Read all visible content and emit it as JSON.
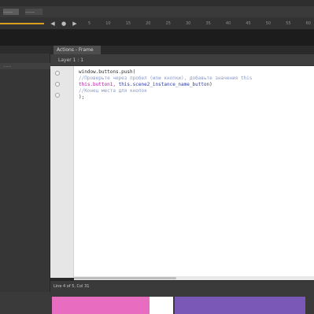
{
  "menubar": {
    "items": [
      "……",
      "……"
    ]
  },
  "timeline": {
    "buttons": [
      "◀",
      "●",
      "▶"
    ],
    "frame_numbers": [
      "5",
      "10",
      "15",
      "20",
      "25",
      "30",
      "35",
      "40",
      "45",
      "50",
      "55",
      "60"
    ],
    "accent_color": "#d9a020"
  },
  "left_panel": {
    "label": "……"
  },
  "actions_panel": {
    "tab_label": "Actions - Frame",
    "header_label": "Layer 1 : 1",
    "code_lines": [
      {
        "text": "window.buttons.push(",
        "style": "default"
      },
      {
        "text": "//Проверьте через пробел (или кнопки), добавьте значения this",
        "style": "comment"
      },
      {
        "text": "this.button1, this.scene2_instance_name_button)",
        "style": "mixed",
        "keyword": "this.button1, ",
        "ident": "this.scene2_instance_name_button",
        "rest": ")"
      },
      {
        "text": "//Конец места для кнопок",
        "style": "comment"
      },
      {
        "text": ");",
        "style": "default"
      }
    ],
    "status_label": "Line 4 of 5, Col 31"
  },
  "colors": {
    "swatch_pink": "#e86cc0",
    "swatch_purple": "#7a58b8",
    "code_keyword": "#b01aa8",
    "code_comment": "#8a9ac8"
  }
}
